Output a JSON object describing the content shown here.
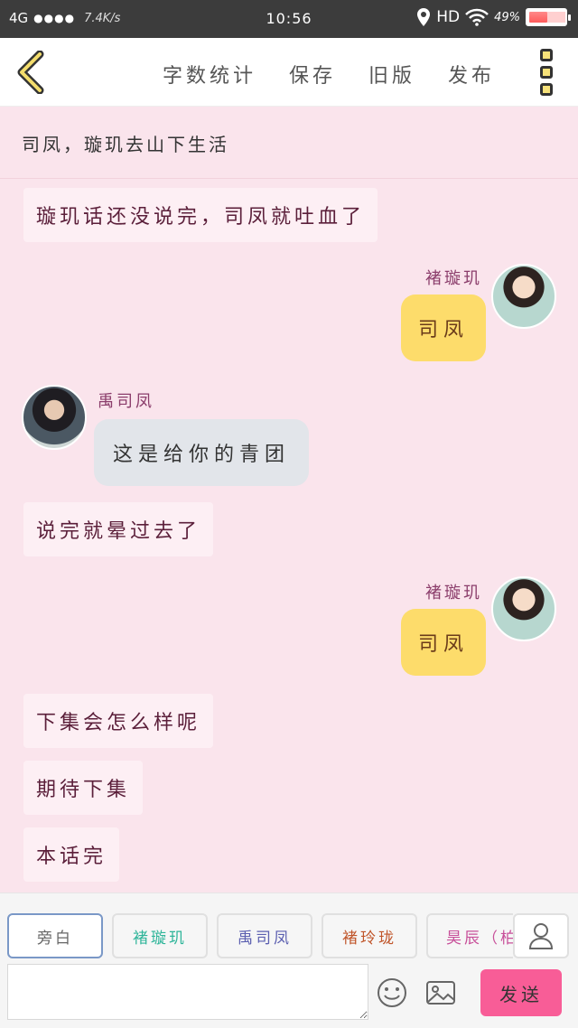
{
  "status_bar": {
    "network": "4G",
    "signal_dots": "●●●●",
    "speed": "7.4K/s",
    "time": "10:56",
    "hd": "HD",
    "battery": "49%",
    "battery_level": 0.49
  },
  "toolbar": {
    "actions": [
      "字数统计",
      "保存",
      "旧版",
      "发布"
    ]
  },
  "chat": {
    "title": "司凤，璇玑去山下生活",
    "messages": [
      {
        "kind": "narration",
        "text": "璇玑话还没说完，司凤就吐血了"
      },
      {
        "kind": "right",
        "speaker": "褚璇玑",
        "text": "司凤"
      },
      {
        "kind": "left",
        "speaker": "禹司凤",
        "text": "这是给你的青团"
      },
      {
        "kind": "narration",
        "text": "说完就晕过去了"
      },
      {
        "kind": "right",
        "speaker": "褚璇玑",
        "text": "司凤"
      },
      {
        "kind": "narration",
        "text": "下集会怎么样呢"
      },
      {
        "kind": "narration",
        "text": "期待下集"
      },
      {
        "kind": "narration",
        "text": "本话完"
      }
    ]
  },
  "roles": [
    {
      "label": "旁白",
      "color": "#666666"
    },
    {
      "label": "褚璇玑",
      "color": "#2fb59a"
    },
    {
      "label": "禹司凤",
      "color": "#5b5fb0"
    },
    {
      "label": "褚玲珑",
      "color": "#c0552a"
    },
    {
      "label": "昊辰（柏麟",
      "color": "#c8509a"
    }
  ],
  "input": {
    "placeholder": ""
  },
  "send_label": "发送",
  "colors": {
    "background": "#fae4ec",
    "yellow_bubble": "#fddc6b",
    "gray_bubble": "#e2e5ea",
    "send_button": "#f85d97",
    "speaker_right": "#8b3d6b",
    "speaker_left": "#8b3d6b"
  }
}
